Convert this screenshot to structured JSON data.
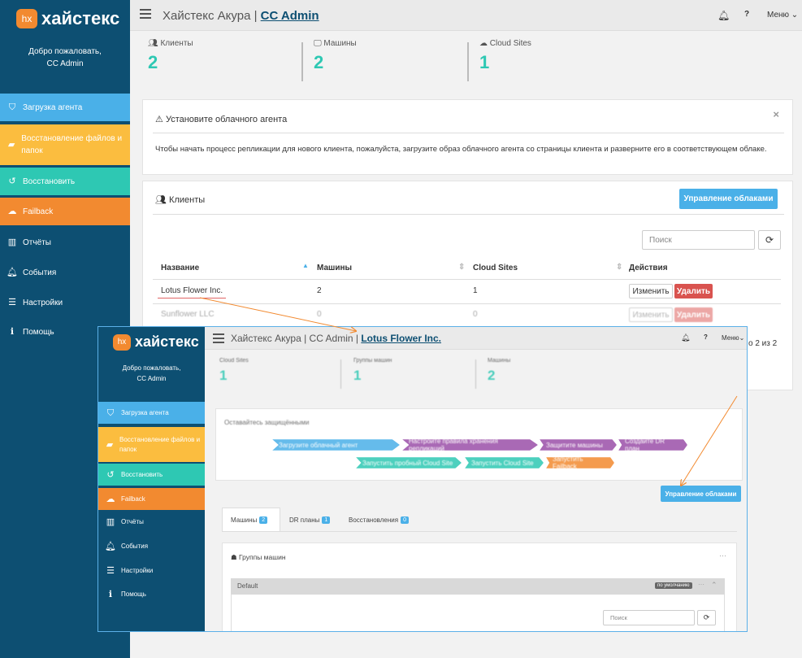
{
  "sidebar": {
    "logo_mark": "hx",
    "logo_text": "хайстекс",
    "welcome_line1": "Добро пожаловать,",
    "welcome_line2": "CC Admin",
    "items": [
      {
        "label": "Загрузка агента",
        "color": "#4ab0e8",
        "icon": "shield-icon"
      },
      {
        "label": "Восстановление файлов и папок",
        "color": "#fbbd3f",
        "icon": "folder-icon"
      },
      {
        "label": "Восстановить",
        "color": "#2ec8b3",
        "icon": "undo-icon"
      },
      {
        "label": "Failback",
        "color": "#f28a30",
        "icon": "cloud-download-icon"
      },
      {
        "label": "Отчёты",
        "icon": "bar-chart-icon"
      },
      {
        "label": "События",
        "icon": "bell-icon"
      },
      {
        "label": "Настройки",
        "icon": "sliders-icon"
      },
      {
        "label": "Помощь",
        "icon": "info-icon"
      }
    ]
  },
  "header": {
    "title_prefix": "Хайстекс Акура | ",
    "title_link": "CC Admin",
    "help": "?",
    "menu": "Меню"
  },
  "stats": [
    {
      "label": "Клиенты",
      "value": "2"
    },
    {
      "label": "Машины",
      "value": "2"
    },
    {
      "label": "Cloud Sites",
      "value": "1"
    }
  ],
  "notice": {
    "title": "Установите облачного агента",
    "close": "×",
    "text": "Чтобы начать процесс репликации для нового клиента, пожалуйста, загрузите образ облачного агента со страницы клиента и разверните его в соответствующем облаке."
  },
  "clients": {
    "title": "Клиенты",
    "manage_button": "Управление облаками",
    "search_placeholder": "Поиск",
    "columns": [
      "Название",
      "Машины",
      "Cloud Sites",
      "Действия"
    ],
    "rows": [
      {
        "name": "Lotus Flower Inc.",
        "machines": "2",
        "sites": "1"
      },
      {
        "name": "Sunflower LLC",
        "machines": "0",
        "sites": "0"
      }
    ],
    "edit": "Изменить",
    "delete": "Удалить",
    "pager": "о 2 из 2"
  },
  "inset": {
    "title_prefix": "Хайстекс Акура | CC Admin | ",
    "title_link": "Lotus Flower Inc.",
    "stats": [
      {
        "label": "Cloud Sites",
        "value": "1"
      },
      {
        "label": "Группы машин",
        "value": "1"
      },
      {
        "label": "Машины",
        "value": "2"
      }
    ],
    "setup_title": "Оставайтесь защищёнными",
    "steps": [
      {
        "label": "Загрузите облачный агент",
        "color": "#4ab0e8"
      },
      {
        "label": "Настройте правила хранения репликаций",
        "color": "#9b4fa8"
      },
      {
        "label": "Защитите машины",
        "color": "#9b4fa8"
      },
      {
        "label": "Создайте DR план",
        "color": "#9b4fa8"
      },
      {
        "label": "Запустить пробный Cloud Site",
        "color": "#2ec8b3"
      },
      {
        "label": "Запустить Cloud Site",
        "color": "#2ec8b3"
      },
      {
        "label": "Запустить Failback",
        "color": "#f28a30"
      }
    ],
    "manage_button": "Управление облаками",
    "tabs": [
      {
        "label": "Машины",
        "badge": "2"
      },
      {
        "label": "DR планы",
        "badge": "1"
      },
      {
        "label": "Восстановления",
        "badge": "0"
      }
    ],
    "groups_title": "Группы машин",
    "group_default": "Default",
    "default_badge": "по умолчанию",
    "search_placeholder": "Поиск",
    "dots": "···"
  }
}
